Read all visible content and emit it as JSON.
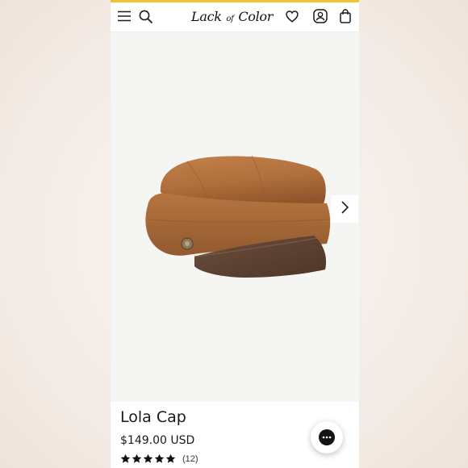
{
  "brand": {
    "logo_text_1": "Lack",
    "logo_text_2": "of",
    "logo_text_3": "Color",
    "accent_color": "#f2c230"
  },
  "header": {
    "menu_icon": "hamburger-menu-icon",
    "search_icon": "search-icon",
    "wishlist_icon": "heart-icon",
    "account_icon": "user-account-icon",
    "cart_icon": "shopping-bag-icon"
  },
  "gallery": {
    "next_icon": "chevron-right-icon"
  },
  "product": {
    "title": "Lola Cap",
    "price": "$149.00 USD",
    "rating_stars": 5,
    "review_count": "(12)"
  },
  "chat": {
    "icon": "chat-bubble-icon"
  }
}
